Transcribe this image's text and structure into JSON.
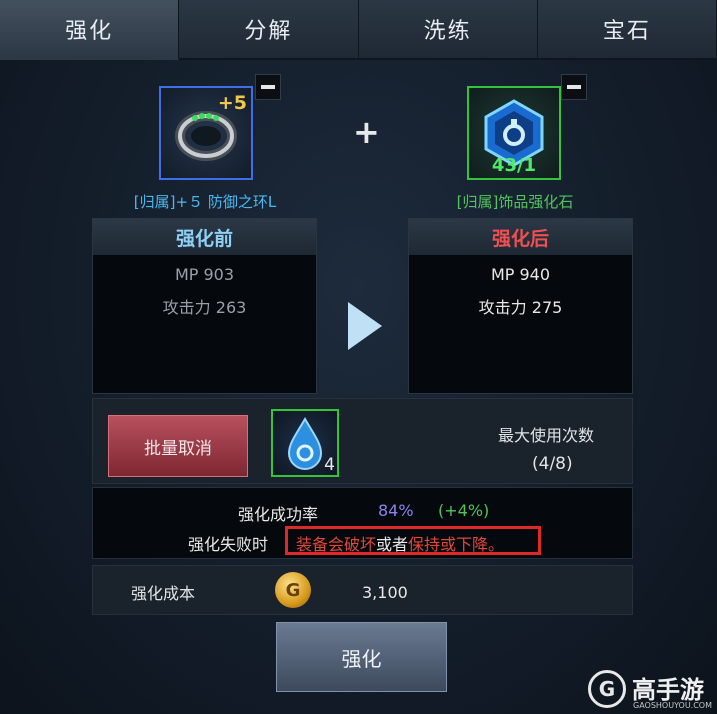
{
  "tabs": [
    {
      "label": "强化"
    },
    {
      "label": "分解"
    },
    {
      "label": "洗练"
    },
    {
      "label": "宝石"
    }
  ],
  "equipment": {
    "enhance_badge": "+5",
    "name": "[归属]+５ 防御之环L"
  },
  "material": {
    "count": "43/1",
    "name": "[归属]饰品强化石"
  },
  "plus_symbol": "+",
  "before": {
    "title": "强化前",
    "mp": "MP 903",
    "atk": "攻击力 263"
  },
  "after": {
    "title": "强化后",
    "mp": "MP 940",
    "atk": "攻击力 275"
  },
  "batch_cancel_label": "批量取消",
  "consumable_count": "4",
  "max_use": {
    "label": "最大使用次数",
    "value": "(4/8)"
  },
  "success": {
    "label": "强化成功率",
    "rate": "84%",
    "bonus": "(+4%)"
  },
  "fail": {
    "label": "强化失败时",
    "part1": "装备会破坏",
    "part2": "或者",
    "part3": "保持或下降。"
  },
  "cost": {
    "label": "强化成本",
    "value": "3,100"
  },
  "coin_glyph": "G",
  "enhance_button": "强化",
  "watermark": {
    "brand": "高手游",
    "domain": "GAOSHOUYOU.COM",
    "logo_glyph": "G"
  },
  "colors": {
    "success_rate": "#8a84f0",
    "bonus": "#52c45a",
    "warning_red": "#e04838",
    "before_title": "#8fd0f5",
    "after_title": "#f05050"
  }
}
